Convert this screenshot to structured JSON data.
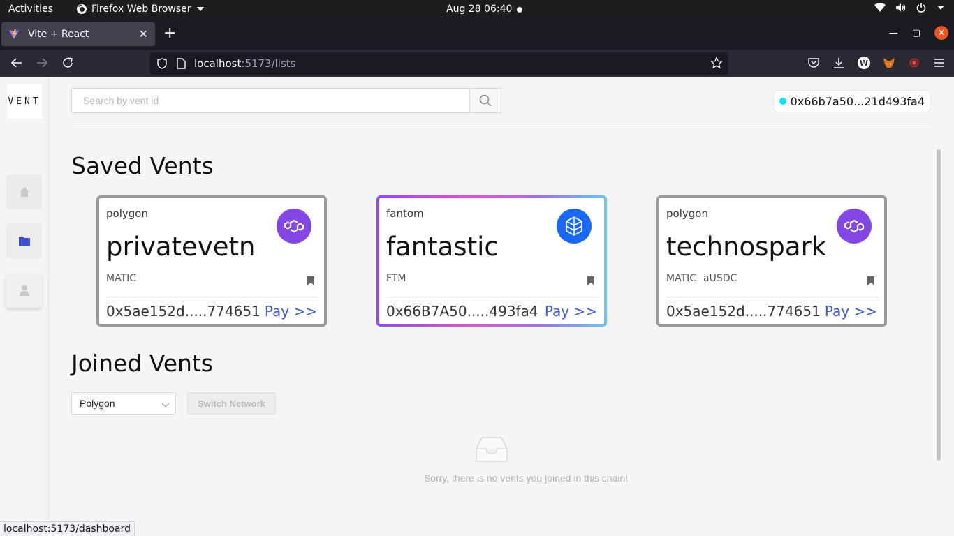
{
  "system": {
    "activities": "Activities",
    "app_name": "Firefox Web Browser",
    "clock": "Aug 28  06:40"
  },
  "browser": {
    "tab_title": "Vite + React",
    "url_host": "localhost",
    "url_rest": ":5173/lists",
    "status_url": "localhost:5173/dashboard"
  },
  "app": {
    "logo": "VENT",
    "search_placeholder": "Search by vent id",
    "wallet_address": "0x66b7a50...21d493fa4",
    "saved_title": "Saved Vents",
    "joined_title": "Joined Vents",
    "network_select": "Polygon",
    "switch_button": "Switch Network",
    "empty_message": "Sorry, there is no vents you joined in this chain!"
  },
  "cards": [
    {
      "network": "polygon",
      "name": "privatevetn",
      "token1": "MATIC",
      "token2": "",
      "address": "0x5ae152d.....774651",
      "pay": "Pay >>",
      "coin_color": "#8247e5"
    },
    {
      "network": "fantom",
      "name": "fantastic",
      "token1": "FTM",
      "token2": "",
      "address": "0x66B7A50.....493fa4",
      "pay": "Pay >>",
      "coin_color": "#1969ff"
    },
    {
      "network": "polygon",
      "name": "technospark",
      "token1": "MATIC",
      "token2": "aUSDC",
      "address": "0x5ae152d.....774651",
      "pay": "Pay >>",
      "coin_color": "#8247e5"
    }
  ]
}
